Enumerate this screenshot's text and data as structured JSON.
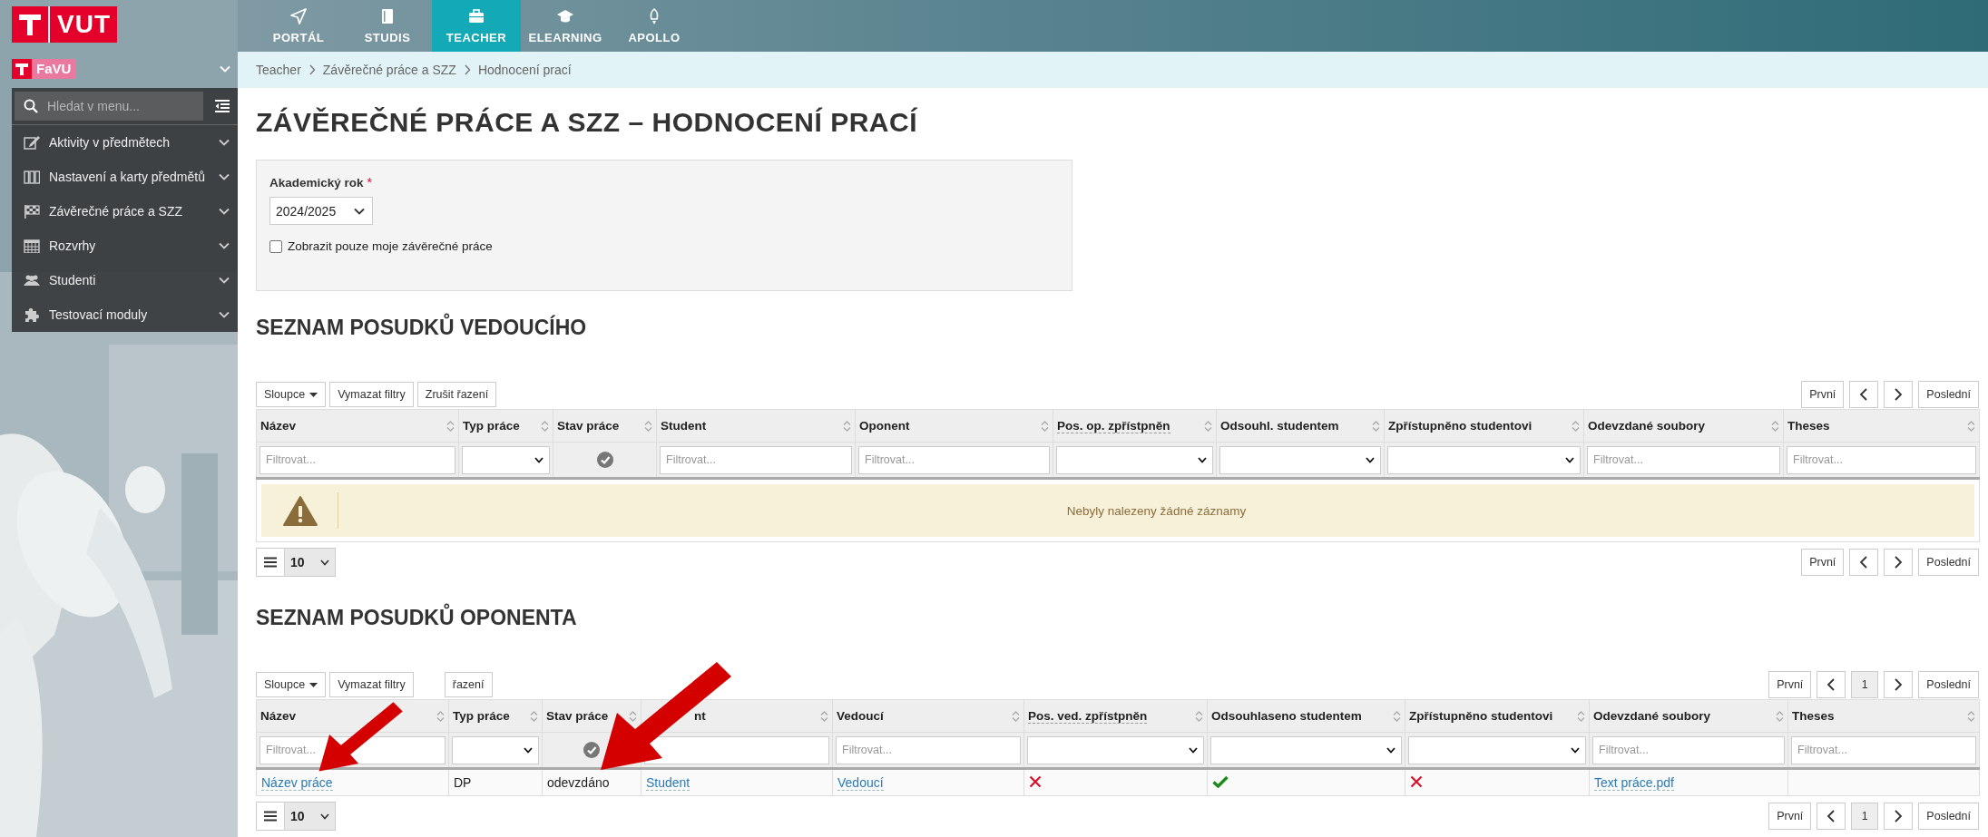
{
  "brand": {
    "logo": "VUT"
  },
  "nav": [
    {
      "label": "PORTÁL",
      "selected": false
    },
    {
      "label": "STUDIS",
      "selected": false
    },
    {
      "label": "TEACHER",
      "selected": true
    },
    {
      "label": "ELEARNING",
      "selected": false
    },
    {
      "label": "APOLLO",
      "selected": false
    }
  ],
  "sidebar": {
    "faculty": "FaVU",
    "search": {
      "placeholder": "Hledat v menu..."
    },
    "items": [
      {
        "label": "Aktivity v předmětech"
      },
      {
        "label": "Nastavení a karty předmětů"
      },
      {
        "label": "Závěrečné práce a SZZ"
      },
      {
        "label": "Rozvrhy"
      },
      {
        "label": "Studenti"
      },
      {
        "label": "Testovací moduly"
      }
    ]
  },
  "breadcrumb": [
    "Teacher",
    "Závěrečné práce a SZZ",
    "Hodnocení prací"
  ],
  "title": "ZÁVĚREČNÉ PRÁCE A SZZ – HODNOCENÍ PRACÍ",
  "form": {
    "year_label": "Akademický rok",
    "required_mark": "*",
    "year": "2024/2025",
    "only_mine": {
      "label": "Zobrazit pouze moje závěrečné práce",
      "checked": false
    }
  },
  "tables": [
    {
      "heading": "SEZNAM POSUDKŮ VEDOUCÍHO",
      "toolbar": [
        {
          "label": "Sloupce",
          "dropdown": true
        },
        {
          "label": "Vymazat filtry"
        },
        {
          "label": "Zrušit řazení"
        }
      ],
      "pager_top": {
        "first": "První",
        "last": "Poslední"
      },
      "columns": [
        {
          "label": "Název",
          "kind": "text",
          "placeholder": "Filtrovat..."
        },
        {
          "label": "Typ práce",
          "kind": "select"
        },
        {
          "label": "Stav práce",
          "kind": "status"
        },
        {
          "label": "Student",
          "kind": "text",
          "placeholder": "Filtrovat..."
        },
        {
          "label": "Oponent",
          "kind": "text",
          "placeholder": "Filtrovat..."
        },
        {
          "label": "Pos. op. zpřístpněn",
          "kind": "select",
          "abbr": true
        },
        {
          "label": "Odsouhl. studentem",
          "kind": "select"
        },
        {
          "label": "Zpřístupněno studentovi",
          "kind": "select"
        },
        {
          "label": "Odevzdané soubory",
          "kind": "text",
          "placeholder": "Filtrovat..."
        },
        {
          "label": "Theses",
          "kind": "text",
          "placeholder": "Filtrovat..."
        }
      ],
      "empty_message": "Nebyly nalezeny žádné záznamy",
      "page_size": "10",
      "pager_bottom": {
        "first": "První",
        "last": "Poslední"
      }
    },
    {
      "heading": "SEZNAM POSUDKŮ OPONENTA",
      "toolbar": [
        {
          "label": "Sloupce",
          "dropdown": true
        },
        {
          "label": "Vymazat filtry"
        },
        {
          "label": "řazení",
          "partly_hidden": true
        }
      ],
      "pager_top": {
        "first": "První",
        "last": "Poslední",
        "pages": [
          {
            "label": "1",
            "selected": true
          }
        ]
      },
      "columns": [
        {
          "label": "Název",
          "kind": "text",
          "placeholder": "Filtrovat..."
        },
        {
          "label": "Typ práce",
          "kind": "select"
        },
        {
          "label": "Stav práce",
          "kind": "status"
        },
        {
          "label": "nt",
          "kind": "text",
          "partly_hidden": true
        },
        {
          "label": "Vedoucí",
          "kind": "text",
          "placeholder": "Filtrovat..."
        },
        {
          "label": "Pos. ved. zpřístpněn",
          "kind": "select",
          "abbr": true
        },
        {
          "label": "Odsouhlaseno studentem",
          "kind": "select"
        },
        {
          "label": "Zpřístupněno studentovi",
          "kind": "select"
        },
        {
          "label": "Odevzdané soubory",
          "kind": "text",
          "placeholder": "Filtrovat..."
        },
        {
          "label": "Theses",
          "kind": "text",
          "placeholder": "Filtrovat..."
        }
      ],
      "rows": [
        {
          "cells": [
            {
              "kind": "link",
              "text": "Název práce",
              "arrow": true
            },
            {
              "kind": "text",
              "text": "DP"
            },
            {
              "kind": "text",
              "text": "odevzdáno",
              "arrow": true
            },
            {
              "kind": "link",
              "text": "Student"
            },
            {
              "kind": "link",
              "text": "Vedoucí"
            },
            {
              "kind": "bool",
              "value": false
            },
            {
              "kind": "bool",
              "value": true
            },
            {
              "kind": "bool",
              "value": false
            },
            {
              "kind": "link",
              "text": "Text práce.pdf"
            },
            {
              "kind": "empty"
            }
          ]
        }
      ],
      "page_size": "10",
      "pager_bottom": {
        "first": "První",
        "last": "Poslední",
        "pages": [
          {
            "label": "1",
            "selected": true
          }
        ]
      }
    }
  ]
}
